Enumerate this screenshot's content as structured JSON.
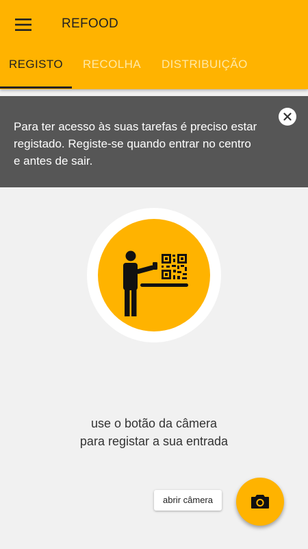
{
  "app": {
    "title": "REFOOD",
    "accent": "#ffb300",
    "menu_icon": "hamburger-menu-icon"
  },
  "tabs": [
    {
      "label": "REGISTO",
      "active": true
    },
    {
      "label": "RECOLHA",
      "active": false
    },
    {
      "label": "DISTRIBUIÇÃO",
      "active": false
    }
  ],
  "banner": {
    "message": "Para ter acesso às suas tarefas é preciso estar registado. Registe-se quando entrar no centro e antes de sair.",
    "close_icon": "close-icon",
    "background": "#565656"
  },
  "main": {
    "illustration": "person-scanning-qr-code",
    "instruction_line1": "use o botão da câmera",
    "instruction_line2": "para registar a sua entrada"
  },
  "camera": {
    "label": "abrir câmera",
    "icon": "camera-icon"
  }
}
